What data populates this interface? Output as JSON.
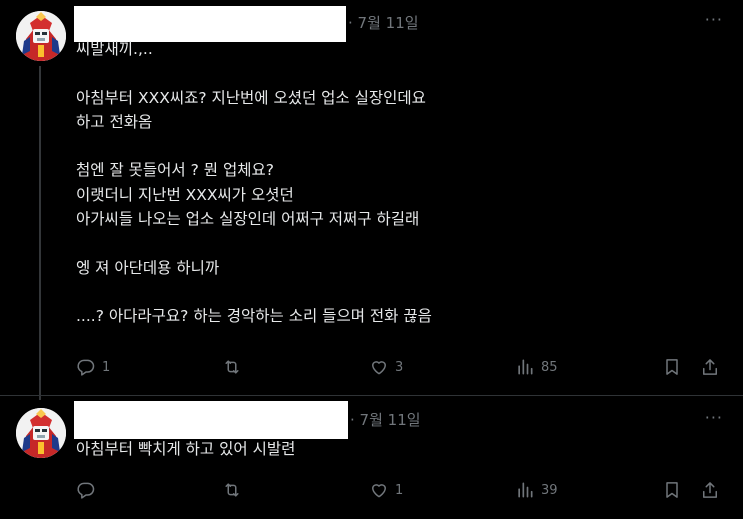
{
  "posts": [
    {
      "date": "· 7월 11일",
      "more": "···",
      "lines": [
        "씨발새끼.,..",
        "",
        "아침부터 XXX씨죠? 지난번에 오셨던 업소 실장인데요",
        "하고 전화옴",
        "",
        "첨엔 잘 못들어서 ? 뭔 업체요?",
        "이랫더니 지난번 XXX씨가 오셧던",
        "아가씨들 나오는 업소 실장인데 어쩌구 저쩌구 하길래",
        "",
        "엥 져 아단데용 하니까",
        "",
        "....? 아다라구요? 하는 경악하는 소리 들으며 전화 끊음"
      ],
      "replies": "1",
      "reposts": "",
      "likes": "3",
      "views": "85"
    },
    {
      "date": "· 7월 11일",
      "more": "···",
      "lines": [
        "아침부터 빡치게 하고 있어 시발련"
      ],
      "replies": "",
      "reposts": "",
      "likes": "1",
      "views": "39"
    }
  ],
  "icons": {
    "reply": "reply-icon",
    "repost": "repost-icon",
    "like": "heart-icon",
    "views": "views-icon",
    "bookmark": "bookmark-icon",
    "share": "share-icon",
    "more": "more-icon"
  },
  "colors": {
    "background": "#000000",
    "text": "#e7e9ea",
    "secondary": "#71767b",
    "divider": "#2f3336"
  }
}
